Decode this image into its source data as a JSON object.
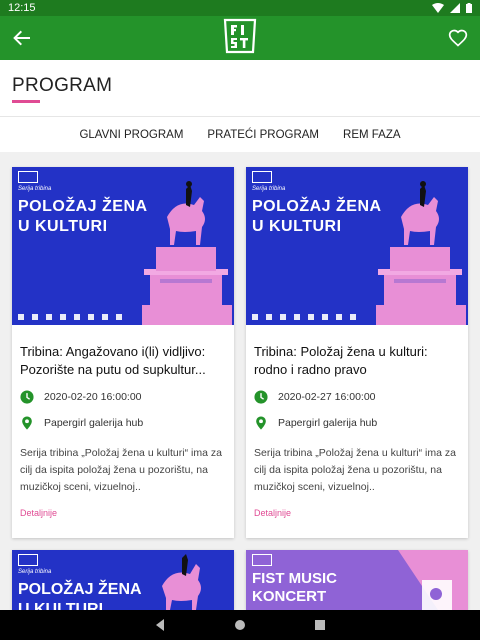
{
  "status": {
    "time": "12:15"
  },
  "header": {
    "title": "PROGRAM"
  },
  "tabs": [
    "GLAVNI PROGRAM",
    "PRATEĆI PROGRAM",
    "REM FAZA"
  ],
  "cards": [
    {
      "image_series": "Serija tribina",
      "image_title_1": "POLOŽAJ ŽENA",
      "image_title_2": "U KULTURI",
      "title": "Tribina: Angažovano i(li) vidljivo: Pozorište na putu od supkultur...",
      "datetime": "2020-02-20 16:00:00",
      "venue": "Papergirl galerija hub",
      "description": "Serija tribina „Položaj žena u kulturi“ ima za cilj da ispita položaj žena u pozorištu, na muzičkoj sceni, vizuelnoj..",
      "more": "Detaljnije"
    },
    {
      "image_series": "Serija tribina",
      "image_title_1": "POLOŽAJ ŽENA",
      "image_title_2": "U KULTURI",
      "title": "Tribina: Položaj žena u kulturi: rodno i radno pravo",
      "datetime": "2020-02-27 16:00:00",
      "venue": "Papergirl galerija hub",
      "description": "Serija tribina „Položaj žena u kulturi“ ima za cilj da ispita položaj žena u pozorištu, na muzičkoj sceni, vizuelnoj..",
      "more": "Detaljnije"
    },
    {
      "image_series": "Serija tribina",
      "image_title_1": "POLOŽAJ ŽENA",
      "image_title_2": "U KULTURI"
    },
    {
      "image_title_1": "FIST MUSIC",
      "image_title_2": "KONCERT"
    }
  ],
  "icons": {
    "back": "arrow-left-icon",
    "favorite": "heart-outline-icon",
    "date": "clock-icon",
    "venue": "location-pin-icon"
  },
  "colors": {
    "status_bar": "#1e7b1f",
    "app_bar": "#24932a",
    "accent": "#e04b94",
    "poster_blue": "#2332c6",
    "poster_pink": "#e88fd6"
  }
}
